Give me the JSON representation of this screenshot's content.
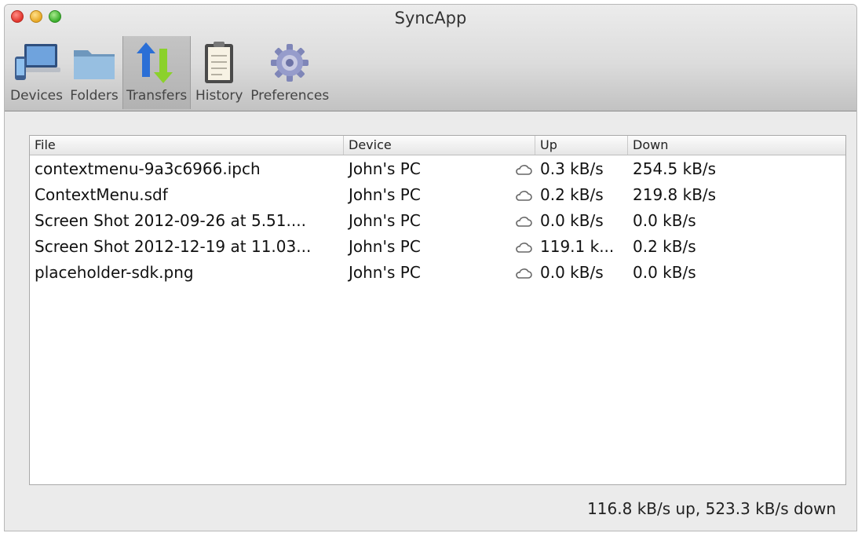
{
  "window": {
    "title": "SyncApp"
  },
  "toolbar": {
    "items": [
      {
        "label": "Devices",
        "icon": "devices-icon"
      },
      {
        "label": "Folders",
        "icon": "folder-icon"
      },
      {
        "label": "Transfers",
        "icon": "transfer-arrows-icon",
        "selected": true
      },
      {
        "label": "History",
        "icon": "clipboard-icon"
      },
      {
        "label": "Preferences",
        "icon": "gear-icon"
      }
    ]
  },
  "table": {
    "columns": {
      "file": "File",
      "device": "Device",
      "up": "Up",
      "down": "Down"
    },
    "rows": [
      {
        "file": "contextmenu-9a3c6966.ipch",
        "device": "John's PC",
        "up": "0.3 kB/s",
        "down": "254.5 kB/s"
      },
      {
        "file": "ContextMenu.sdf",
        "device": "John's PC",
        "up": "0.2 kB/s",
        "down": "219.8 kB/s"
      },
      {
        "file": "Screen Shot 2012-09-26 at 5.51....",
        "device": "John's PC",
        "up": "0.0 kB/s",
        "down": "0.0 kB/s"
      },
      {
        "file": "Screen Shot 2012-12-19 at 11.03...",
        "device": "John's PC",
        "up": "119.1 k...",
        "down": "0.2 kB/s"
      },
      {
        "file": "placeholder-sdk.png",
        "device": "John's PC",
        "up": "0.0 kB/s",
        "down": "0.0 kB/s"
      }
    ]
  },
  "status": {
    "text": "116.8 kB/s up, 523.3 kB/s down"
  }
}
